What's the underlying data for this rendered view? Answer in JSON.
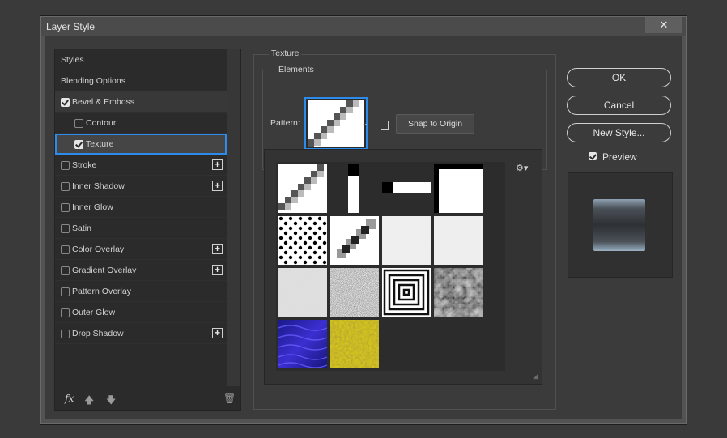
{
  "window": {
    "title": "Layer Style",
    "close_glyph": "✕"
  },
  "styles_panel": {
    "items": [
      {
        "label": "Styles",
        "checkbox": null,
        "add": false
      },
      {
        "label": "Blending Options",
        "checkbox": null,
        "add": false
      },
      {
        "label": "Bevel & Emboss",
        "checkbox": true,
        "add": false
      },
      {
        "label": "Contour",
        "checkbox": false,
        "add": false
      },
      {
        "label": "Texture",
        "checkbox": true,
        "add": false
      },
      {
        "label": "Stroke",
        "checkbox": false,
        "add": true
      },
      {
        "label": "Inner Shadow",
        "checkbox": false,
        "add": true
      },
      {
        "label": "Inner Glow",
        "checkbox": false,
        "add": false
      },
      {
        "label": "Satin",
        "checkbox": false,
        "add": false
      },
      {
        "label": "Color Overlay",
        "checkbox": false,
        "add": true
      },
      {
        "label": "Gradient Overlay",
        "checkbox": false,
        "add": true
      },
      {
        "label": "Pattern Overlay",
        "checkbox": false,
        "add": false
      },
      {
        "label": "Outer Glow",
        "checkbox": false,
        "add": false
      },
      {
        "label": "Drop Shadow",
        "checkbox": false,
        "add": true
      }
    ],
    "bottom_icons": [
      "fx-icon",
      "arrow-up-icon",
      "arrow-down-icon",
      "trash-icon"
    ],
    "fx_label": "fx"
  },
  "texture": {
    "group_title": "Texture",
    "elements_title": "Elements",
    "pattern_label": "Pattern:",
    "snap_to_origin": "Snap to Origin",
    "patterns": [
      "diagonal-pixel-pattern",
      "vertical-bar-pattern",
      "horizontal-bar-pattern",
      "corner-block-pattern",
      "dots-pattern",
      "diagonal-gray-pattern",
      "light-noise-pattern",
      "fine-noise-pattern",
      "gray-noise-pattern",
      "dark-noise-pattern",
      "concentric-squares-pattern",
      "gray-camo-pattern",
      "blue-water-pattern",
      "yellow-texture-pattern"
    ]
  },
  "buttons": {
    "ok": "OK",
    "cancel": "Cancel",
    "new_style": "New Style..."
  },
  "preview": {
    "label": "Preview",
    "checked": true
  },
  "colors": {
    "accent": "#2d8ceb",
    "panel": "#2b2b2b",
    "dialog": "#3b3b3b"
  }
}
